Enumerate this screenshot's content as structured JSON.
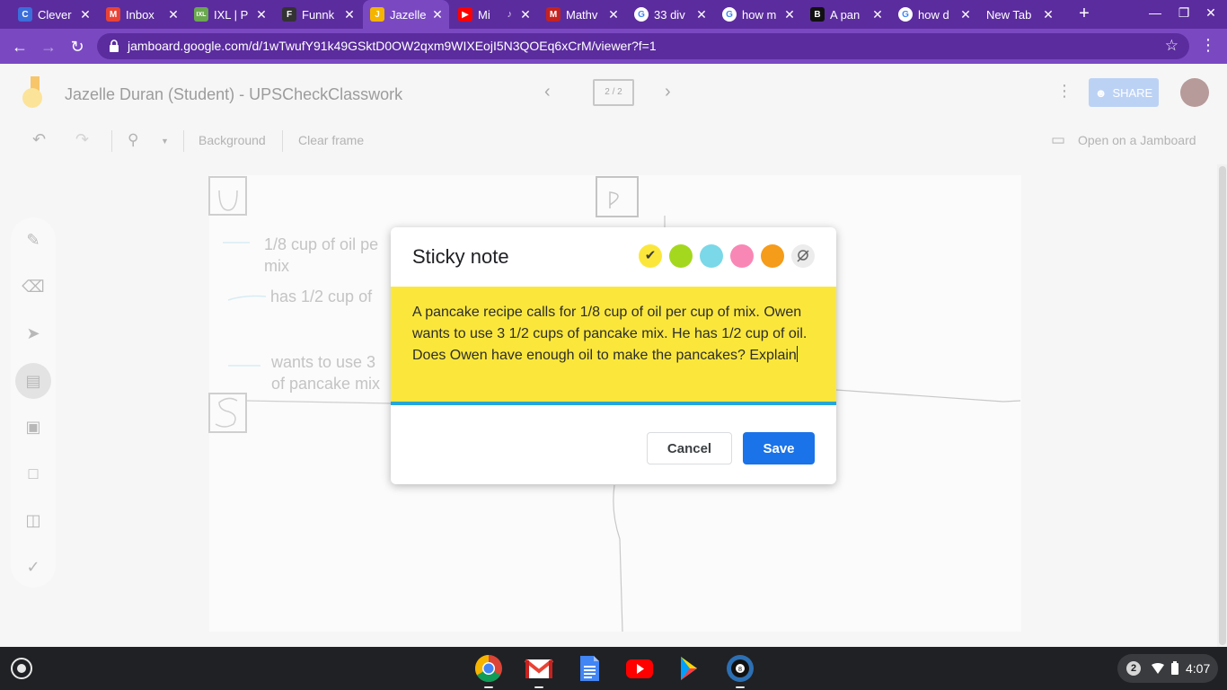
{
  "browser": {
    "tabs": [
      {
        "title": "Clever",
        "icon": "clever-icon",
        "glyph": "C",
        "color": "#3b6ddb"
      },
      {
        "title": "Inbox",
        "icon": "gmail-icon",
        "glyph": "M",
        "color": "#ea4335"
      },
      {
        "title": "IXL | P",
        "icon": "ixl-icon",
        "glyph": "IXL",
        "color": "#6aa84f"
      },
      {
        "title": "Funnk",
        "icon": "funnk-icon",
        "glyph": "F",
        "color": "#333333"
      },
      {
        "title": "Jazelle",
        "icon": "jamboard-icon",
        "glyph": "J",
        "color": "#f4b400",
        "active": true
      },
      {
        "title": "Mi",
        "icon": "youtube-icon",
        "glyph": "▶",
        "color": "#ff0000",
        "audio": true
      },
      {
        "title": "Mathv",
        "icon": "mathway-icon",
        "glyph": "M",
        "color": "#c5221f"
      },
      {
        "title": "33 div",
        "icon": "google-icon",
        "glyph": "G",
        "color": "#ffffff"
      },
      {
        "title": "how m",
        "icon": "google-icon",
        "glyph": "G",
        "color": "#ffffff"
      },
      {
        "title": "A pan",
        "icon": "brainly-icon",
        "glyph": "B",
        "color": "#111111"
      },
      {
        "title": "how d",
        "icon": "google-icon",
        "glyph": "G",
        "color": "#ffffff"
      },
      {
        "title": "New Tab",
        "icon": "",
        "glyph": "",
        "color": ""
      }
    ],
    "url": "jamboard.google.com/d/1wTwufY91k49GSktD0OW2qxm9WIXEojI5N3QOEq6xCrM/viewer?f=1"
  },
  "jamboard": {
    "title": "Jazelle Duran (Student) - UPSCheckClasswork",
    "frame_counter": "2 / 2",
    "share_label": "SHARE",
    "toolbar": {
      "background_label": "Background",
      "clear_frame_label": "Clear frame",
      "open_on_jamboard_label": "Open on a Jamboard"
    },
    "canvas_text": {
      "line1": "1/8 cup of oil pe",
      "line1b": "mix",
      "line2": "has 1/2 cup of",
      "line3": "wants to use 3",
      "line3b": "of pancake mix"
    }
  },
  "dialog": {
    "title": "Sticky note",
    "note_text": "A pancake recipe calls for 1/8 cup of oil per cup of mix. Owen wants to use 3 1/2 cups of pancake mix. He has 1/2 cup of oil. Does Owen have enough oil to make the pancakes? Explain",
    "colors": [
      "#fbe73c",
      "#a4d81e",
      "#7ad8e8",
      "#f987b5",
      "#f59c1a"
    ],
    "cancel_label": "Cancel",
    "save_label": "Save"
  },
  "shelf": {
    "apps": [
      "chrome-icon",
      "gmail-icon",
      "docs-icon",
      "youtube-icon",
      "play-store-icon",
      "pool-game-icon"
    ],
    "notification_count": "2",
    "time": "4:07"
  }
}
